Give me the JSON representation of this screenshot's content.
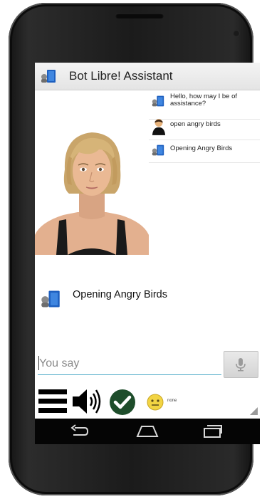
{
  "actionbar": {
    "title": "Bot Libre! Assistant",
    "icon": "bot-libre-icon"
  },
  "chat_log": [
    {
      "speaker": "bot",
      "icon": "bot-libre-icon",
      "text": "Hello, how may I be of assistance?"
    },
    {
      "speaker": "user",
      "icon": "user-icon",
      "text": "open angry birds"
    },
    {
      "speaker": "bot",
      "icon": "bot-libre-icon",
      "text": "Opening Angry Birds"
    }
  ],
  "avatar": {
    "icon": "avatar-woman-image"
  },
  "response": {
    "icon": "bot-libre-icon",
    "text": "Opening Angry Birds"
  },
  "input": {
    "placeholder": "You say",
    "value": ""
  },
  "mic_button": {
    "icon": "microphone-icon"
  },
  "toolbar": {
    "menu_icon": "menu-icon",
    "speaker_icon": "speaker-icon",
    "check_icon": "check-icon",
    "emote_icon": "emote-face-icon",
    "emote_label": "none"
  },
  "navbar": {
    "back": "back-icon",
    "home": "home-icon",
    "recent": "recent-apps-icon"
  },
  "colors": {
    "accent": "#4aa9c7",
    "check_green": "#1e4d2b",
    "navbar": "#050505"
  }
}
